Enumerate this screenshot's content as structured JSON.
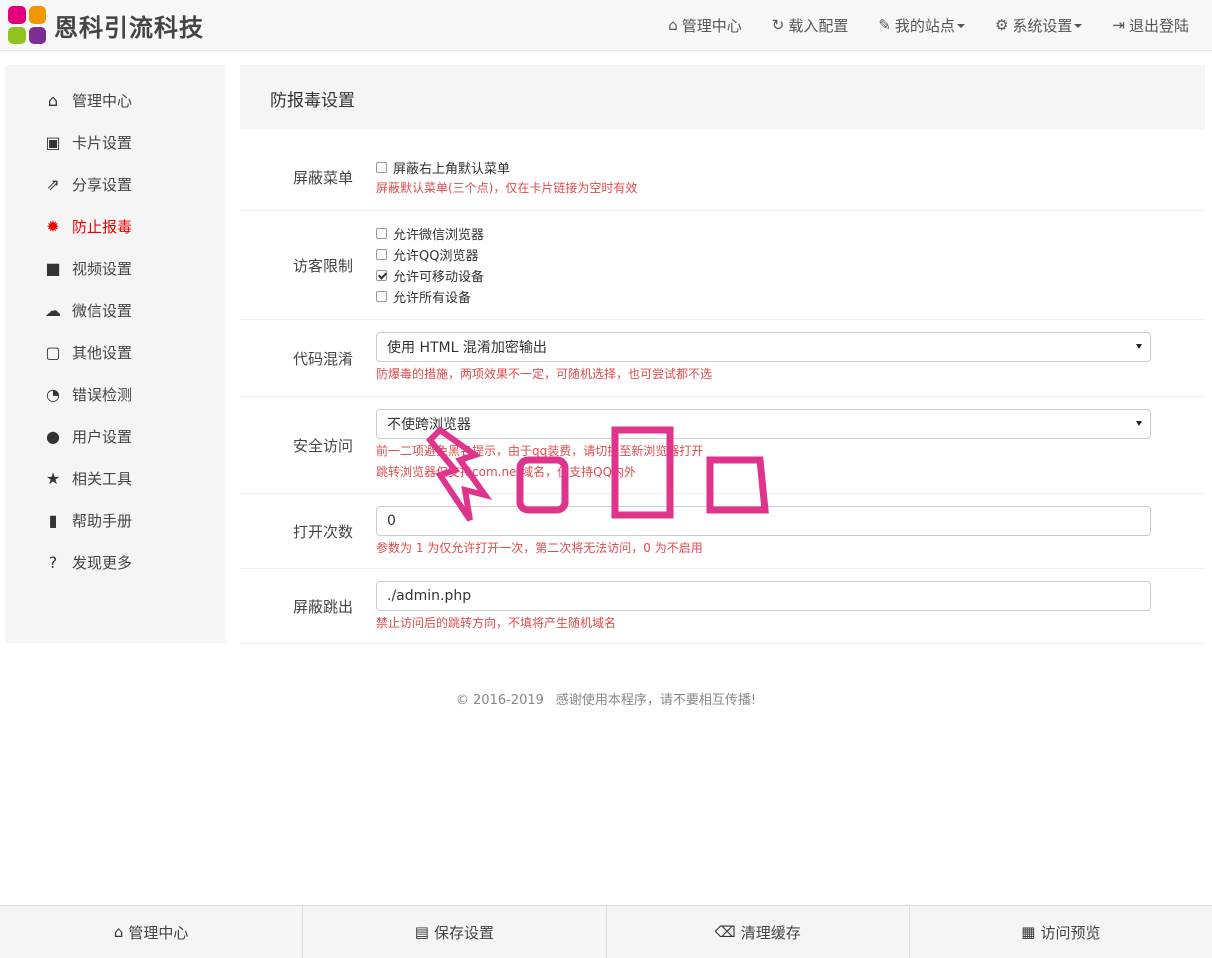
{
  "brand": {
    "name": "恩科引流科技",
    "logo_colors": [
      "#e2007a",
      "#f29600",
      "#8fc31f",
      "#7d2d8f"
    ]
  },
  "topnav": [
    {
      "icon": "home-icon",
      "glyph": "⌂",
      "label": "管理中心",
      "dropdown": false
    },
    {
      "icon": "refresh-icon",
      "glyph": "↻",
      "label": "载入配置",
      "dropdown": false
    },
    {
      "icon": "paperclip-icon",
      "glyph": "✎",
      "label": "我的站点",
      "dropdown": true
    },
    {
      "icon": "gear-icon",
      "glyph": "⚙",
      "label": "系统设置",
      "dropdown": true
    },
    {
      "icon": "logout-icon",
      "glyph": "⇥",
      "label": "退出登陆",
      "dropdown": false
    }
  ],
  "sidebar": {
    "active_color": "#ee0000",
    "items": [
      {
        "icon": "home-icon",
        "glyph": "⌂",
        "label": "管理中心",
        "active": false
      },
      {
        "icon": "card-icon",
        "glyph": "▣",
        "label": "卡片设置",
        "active": false
      },
      {
        "icon": "share-icon",
        "glyph": "⇗",
        "label": "分享设置",
        "active": false
      },
      {
        "icon": "virus-icon",
        "glyph": "✹",
        "label": "防止报毒",
        "active": true
      },
      {
        "icon": "video-icon",
        "glyph": "■",
        "label": "视频设置",
        "active": false
      },
      {
        "icon": "cloud-icon",
        "glyph": "☁",
        "label": "微信设置",
        "active": false
      },
      {
        "icon": "square-icon",
        "glyph": "▢",
        "label": "其他设置",
        "active": false
      },
      {
        "icon": "dashboard-icon",
        "glyph": "◔",
        "label": "错误检测",
        "active": false
      },
      {
        "icon": "user-icon",
        "glyph": "●",
        "label": "用户设置",
        "active": false
      },
      {
        "icon": "star-icon",
        "glyph": "★",
        "label": "相关工具",
        "active": false
      },
      {
        "icon": "book-icon",
        "glyph": "▮",
        "label": "帮助手册",
        "active": false
      },
      {
        "icon": "question-icon",
        "glyph": "?",
        "label": "发现更多",
        "active": false
      }
    ]
  },
  "panel": {
    "title": "防报毒设置",
    "rows": {
      "menu": {
        "label": "屏蔽菜单",
        "checkbox": {
          "label": "屏蔽右上角默认菜单",
          "checked": false
        },
        "help": "屏蔽默认菜单(三个点)，仅在卡片链接为空时有效"
      },
      "visitor": {
        "label": "访客限制",
        "options": [
          {
            "label": "允许微信浏览器",
            "checked": false
          },
          {
            "label": "允许QQ浏览器",
            "checked": false
          },
          {
            "label": "允许可移动设备",
            "checked": true
          },
          {
            "label": "允许所有设备",
            "checked": false
          }
        ]
      },
      "obfuscate": {
        "label": "代码混淆",
        "selected": "使用 HTML 混淆加密输出",
        "help": "防爆毒的措施，两项效果不一定，可随机选择，也可尝试都不选"
      },
      "secure": {
        "label": "安全访问",
        "selected": "不使跨浏览器",
        "help1": "前一二项避免黑名提示，由于qq装费，请切换至新浏览器打开",
        "help2": "跳转浏览器仅支持com.net域名，仅支持QQ内外"
      },
      "open_count": {
        "label": "打开次数",
        "value": "0",
        "help": "参数为 1 为仅允许打开一次，第二次将无法访问，0 为不启用"
      },
      "redirect": {
        "label": "屏蔽跳出",
        "value": "./admin.php",
        "help": "禁止访问后的跳转方向，不填将产生随机域名"
      }
    }
  },
  "footer": {
    "copyright": "© 2016-2019",
    "message": "感谢使用本程序，请不要相互传播!"
  },
  "bottombar": [
    {
      "icon": "home-icon",
      "glyph": "⌂",
      "label": "管理中心"
    },
    {
      "icon": "save-icon",
      "glyph": "▤",
      "label": "保存设置"
    },
    {
      "icon": "eraser-icon",
      "glyph": "⌫",
      "label": "清理缓存"
    },
    {
      "icon": "film-icon",
      "glyph": "▦",
      "label": "访问预览"
    }
  ],
  "watermark_color": "#e0338c"
}
